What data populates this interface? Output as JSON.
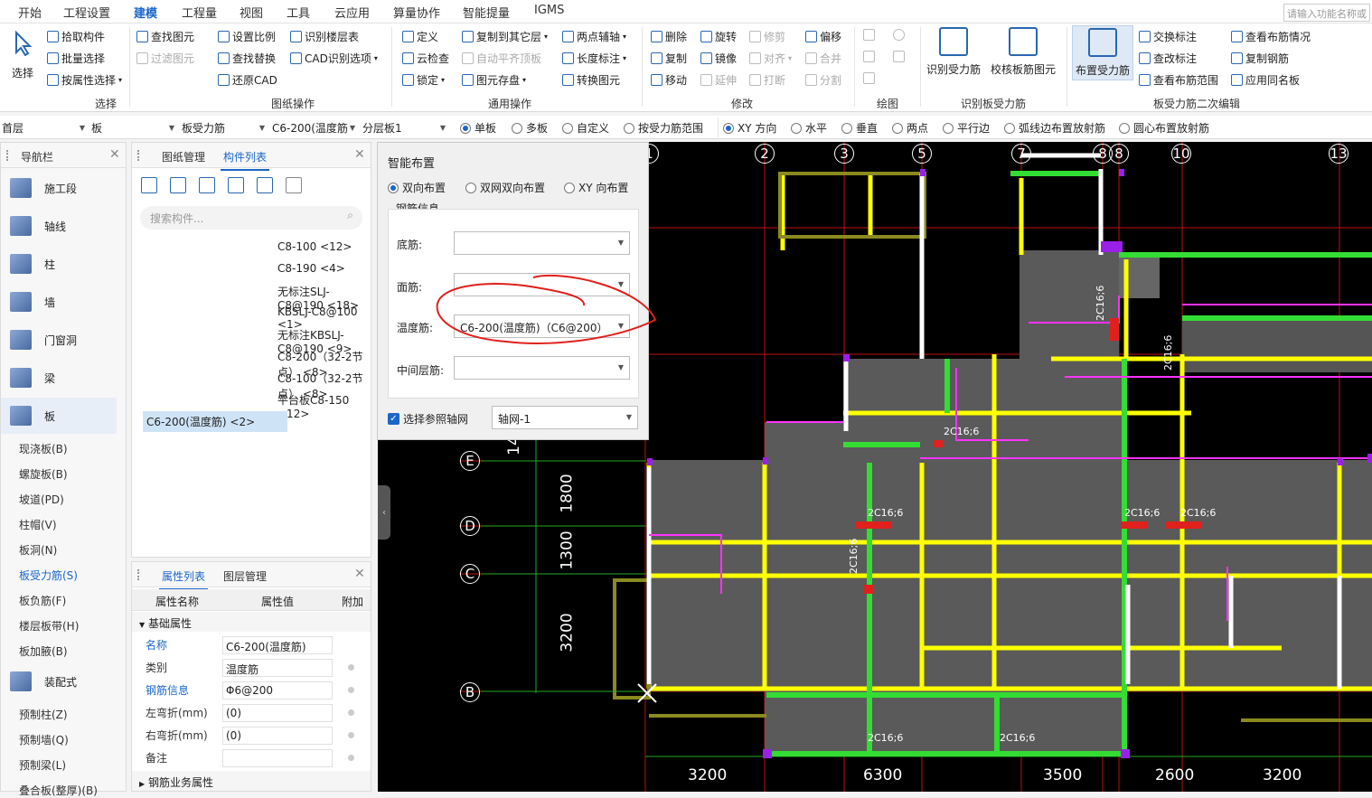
{
  "menubar": {
    "items": [
      "开始",
      "工程设置",
      "建模",
      "工程量",
      "视图",
      "工具",
      "云应用",
      "算量协作",
      "智能提量",
      "IGMS"
    ],
    "active": "建模",
    "search_placeholder": "请输入功能名称或"
  },
  "ribbon": {
    "select_big": "选择",
    "select_items": [
      "拾取构件",
      "批量选择",
      "按属性选择"
    ],
    "select_group": "选择",
    "drawing_col1": [
      "查找图元",
      "过滤图元"
    ],
    "drawing_col2": [
      "设置比例",
      "查找替换",
      "还原CAD"
    ],
    "drawing_col3": [
      "识别楼层表",
      "CAD识别选项"
    ],
    "drawing_group": "图纸操作",
    "general_col1": [
      "定义",
      "云检查",
      "锁定"
    ],
    "general_col2": [
      "复制到其它层",
      "自动平齐顶板",
      "图元存盘"
    ],
    "general_col3": [
      "两点辅轴",
      "长度标注",
      "转换图元"
    ],
    "general_group": "通用操作",
    "modify_col1": [
      "删除",
      "复制",
      "移动"
    ],
    "modify_col2": [
      "旋转",
      "镜像",
      "延伸"
    ],
    "modify_col3": [
      "修剪",
      "对齐",
      "打断"
    ],
    "modify_col4": [
      "偏移",
      "合并",
      "分割"
    ],
    "modify_group": "修改",
    "draw_group": "绘图",
    "recognize_btn1": "识别受力筋",
    "recognize_btn2": "校核板筋图元",
    "recognize_group": "识别板受力筋",
    "layout_btn": "布置受力筋",
    "edit_col1": [
      "交换标注",
      "查改标注",
      "查看布筋范围"
    ],
    "edit_col2": [
      "查看布筋情况",
      "复制钢筋",
      "应用同名板"
    ],
    "edit_group": "板受力筋二次编辑"
  },
  "toolbar": {
    "floor": "首层",
    "category": "板",
    "type": "板受力筋",
    "component": "C6-200(温度筋",
    "layer": "分层板1",
    "radios1": [
      "单板",
      "多板",
      "自定义",
      "按受力筋范围"
    ],
    "radios1_selected": 0,
    "radios2": [
      "XY 方向",
      "水平",
      "垂直",
      "两点",
      "平行边",
      "弧线边布置放射筋",
      "圆心布置放射筋"
    ],
    "radios2_selected": 0
  },
  "nav": {
    "title": "导航栏",
    "items": [
      "施工段",
      "轴线",
      "柱",
      "墙",
      "门窗洞",
      "梁",
      "板"
    ],
    "active": "板",
    "board_subitems": [
      "现浇板(B)",
      "螺旋板(B)",
      "坡道(PD)",
      "柱帽(V)",
      "板洞(N)",
      "板受力筋(S)",
      "板负筋(F)",
      "楼层板带(H)",
      "板加腋(B)"
    ],
    "board_active": "板受力筋(S)",
    "assembly": "装配式",
    "assembly_subitems": [
      "预制柱(Z)",
      "预制墙(Q)",
      "预制梁(L)",
      "叠合板(整厚)(B)"
    ]
  },
  "components": {
    "tabs": [
      "图纸管理",
      "构件列表"
    ],
    "active_tab": "构件列表",
    "search_placeholder": "搜索构件...",
    "items": [
      "C8-100 <12>",
      "C8-190 <4>",
      "无标注SLJ-C8@190 <18>",
      "KBSLJ-C8@100 <1>",
      "无标注KBSLJ-C8@190 <9>",
      "C8-200（32-2节点） <8>",
      "C8-100（32-2节点） <8>",
      "平台板C8-150 <12>",
      "C6-200(温度筋) <2>"
    ],
    "selected": 8
  },
  "properties": {
    "tabs": [
      "属性列表",
      "图层管理"
    ],
    "active_tab": "属性列表",
    "headers": [
      "属性名称",
      "属性值",
      "附加"
    ],
    "section": "基础属性",
    "rows": [
      {
        "name": "名称",
        "value": "C6-200(温度筋)",
        "blue": true
      },
      {
        "name": "类别",
        "value": "温度筋",
        "blue": false
      },
      {
        "name": "钢筋信息",
        "value": "Φ6@200",
        "blue": true
      },
      {
        "name": "左弯折(mm)",
        "value": "(0)",
        "blue": false
      },
      {
        "name": "右弯折(mm)",
        "value": "(0)",
        "blue": false
      },
      {
        "name": "备注",
        "value": "",
        "blue": false
      }
    ],
    "section2": "钢筋业务属性"
  },
  "dialog": {
    "title": "智能布置",
    "modes": [
      "双向布置",
      "双网双向布置",
      "XY 向布置"
    ],
    "mode_selected": 0,
    "group_label": "钢筋信息",
    "bottom_label": "底筋:",
    "bottom_value": "",
    "top_label": "面筋:",
    "top_value": "",
    "temp_label": "温度筋:",
    "temp_value": "C6-200(温度筋)（C6@200）",
    "mid_label": "中间层筋:",
    "mid_value": "",
    "checkbox_label": "选择参照轴网",
    "checkbox_checked": true,
    "grid_value": "轴网-1"
  },
  "cad": {
    "axes_top": [
      "1",
      "2",
      "3",
      "5",
      "7",
      "8",
      "8",
      "10",
      "13"
    ],
    "axes_left": [
      "E",
      "D",
      "C",
      "B"
    ],
    "dims_bottom": [
      "3200",
      "6300",
      "3500",
      "2600",
      "3200"
    ],
    "dims_left": [
      "1800",
      "1300",
      "3200"
    ],
    "partial_left_dim": "14",
    "rebar_labels": [
      "2C16;6",
      "2C16;6",
      "2C16;6",
      "2C16;6",
      "2C16;6",
      "2C16;6",
      "2C16;6",
      "2C16;6",
      "2C16;6",
      "2C16;6"
    ]
  },
  "colors": {
    "accent": "#1a66c9",
    "annotation_red": "#e0201c",
    "wall_yellow": "#ffff00",
    "beam_green": "#33dd33",
    "magenta": "#ff33ff"
  }
}
